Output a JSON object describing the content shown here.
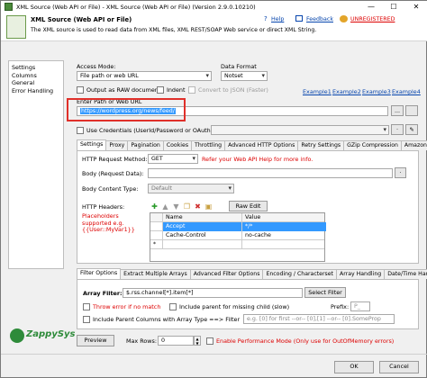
{
  "window": {
    "title": "XML Source (Web API or File) - XML Source (Web API or File) (Version 2.9.0.10210)"
  },
  "header": {
    "title": "XML Source (Web API or File)",
    "description": "The XML source is used to read data from XML files, XML REST/SOAP Web service or direct XML String.",
    "help": "Help",
    "feedback": "Feedback",
    "unregistered": "UNREGISTERED"
  },
  "sidebar": {
    "items": [
      "Settings",
      "Columns",
      "General",
      "Error Handling"
    ]
  },
  "access": {
    "mode_label": "Access Mode:",
    "mode_value": "File path or web URL",
    "format_label": "Data Format",
    "format_value": "Notset",
    "raw_label": "Output as RAW document",
    "indent_label": "Indent",
    "json_label": "Convert to JSON (Faster)",
    "examples": [
      "Example1",
      "Example2",
      "Example3",
      "Example4"
    ],
    "path_label": "Enter Path or Web URL",
    "path_value": "https://wordpress.org/news/feed/",
    "browse": "...",
    "creds_label": "Use Credentials (UserId/Password or OAuth)"
  },
  "tabs": [
    "Settings",
    "Proxy",
    "Pagination",
    "Cookies",
    "Throttling",
    "Advanced HTTP Options",
    "Retry Settings",
    "GZip Compression",
    "Amazon A"
  ],
  "settings": {
    "method_label": "HTTP Request Method:",
    "method_value": "GET",
    "method_hint": "Refer your Web API Help for more info.",
    "body_label": "Body (Request Data):",
    "content_type_label": "Body Content Type:",
    "content_type_value": "Default",
    "headers_label": "HTTP Headers:",
    "raw_edit": "Raw Edit",
    "placeholder_hint": "Placeholders supported e.g. {{User::MyVar1}}",
    "grid_cols": [
      "Name",
      "Value"
    ],
    "grid_rows": [
      [
        "Accept",
        "*/*"
      ],
      [
        "Cache-Control",
        "no-cache"
      ]
    ]
  },
  "filter_tabs": [
    "Filter Options",
    "Extract Multiple Arrays",
    "Advanced Filter Options",
    "Encoding / Characterset",
    "Array Handling",
    "Date/Time Handli"
  ],
  "filter": {
    "array_filter_label": "Array Filter:",
    "array_filter_value": "$.rss.channel[*].item[*]",
    "select_filter": "Select Filter",
    "throw_error": "Throw error if no match",
    "include_parent": "Include parent for missing child (slow)",
    "prefix_label": "Prefix:",
    "prefix_value": "P_",
    "include_parent_cols": "Include Parent Columns with Array Type ==> Filter",
    "include_parent_hint": "e.g. [0] for first --or-- [0],[1] --or-- [0].SomeProp"
  },
  "brand": "ZappySys",
  "footer": {
    "preview": "Preview",
    "max_rows_label": "Max Rows:",
    "max_rows_value": "0",
    "perf_mode": "Enable Performance Mode (Only use for OutOfMemory errors)",
    "ok": "OK",
    "cancel": "Cancel"
  },
  "colors": {
    "red": "#e0302a",
    "link": "#0645ad",
    "selection": "#3399ff"
  }
}
